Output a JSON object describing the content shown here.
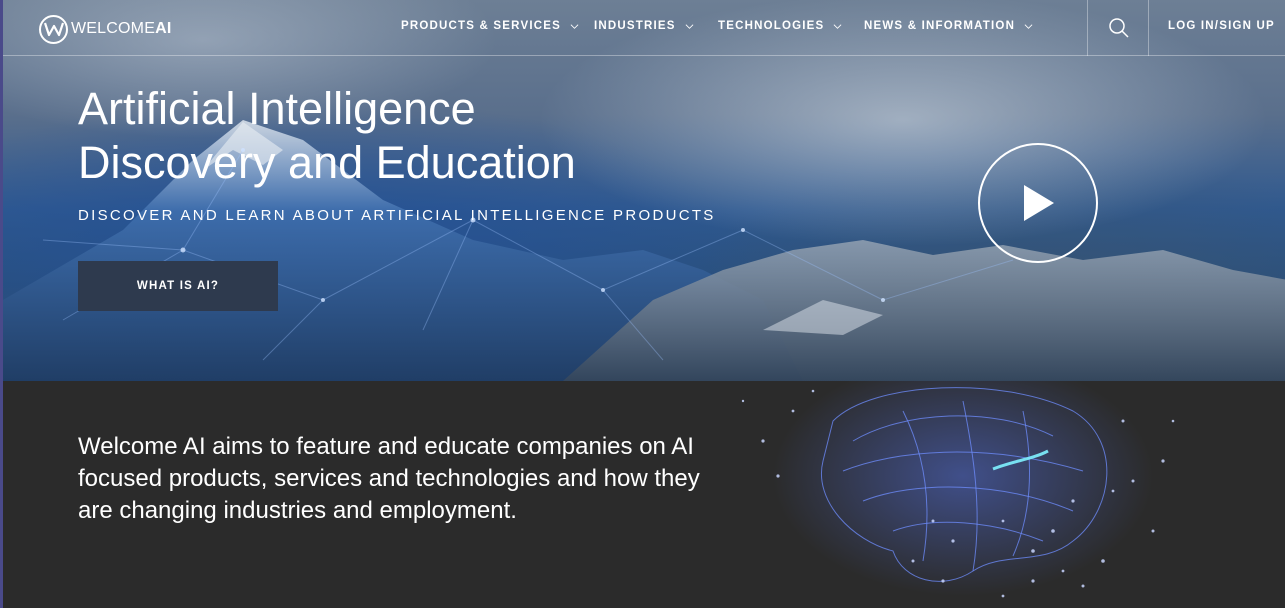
{
  "nav": {
    "logo_text_light": "WELCOME",
    "logo_text_bold": "AI",
    "items": [
      {
        "label": "PRODUCTS & SERVICES"
      },
      {
        "label": "INDUSTRIES"
      },
      {
        "label": "TECHNOLOGIES"
      },
      {
        "label": "NEWS & INFORMATION"
      }
    ],
    "search_icon": "search-icon",
    "login_label": "LOG IN/SIGN UP"
  },
  "hero": {
    "title_line1": "Artificial Intelligence",
    "title_line2": "Discovery and Education",
    "subtitle": "DISCOVER AND LEARN ABOUT ARTIFICIAL INTELLIGENCE PRODUCTS",
    "cta_label": "WHAT IS AI?",
    "play_icon": "play-icon"
  },
  "about": {
    "text": "Welcome AI aims to feature and educate companies on AI focused products, services and technologies and how they are changing industries and employment."
  },
  "colors": {
    "cta_background": "#2e3a4e",
    "section_background": "#2b2b2b",
    "accent_glow": "#5a7cff"
  }
}
